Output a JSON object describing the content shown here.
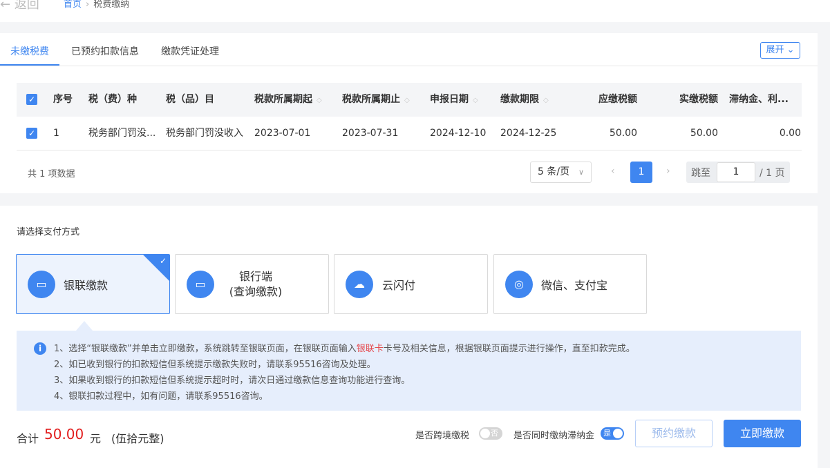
{
  "nav": {
    "back_label": "返回",
    "breadcrumb_home": "首页",
    "breadcrumb_current": "税费缴纳"
  },
  "tabs": {
    "items": [
      {
        "label": "未缴税费",
        "active": true
      },
      {
        "label": "已预约扣款信息",
        "active": false
      },
      {
        "label": "缴款凭证处理",
        "active": false
      }
    ],
    "expand_label": "展开"
  },
  "table": {
    "columns": [
      "序号",
      "税（费）种",
      "税（品）目",
      "税款所属期起",
      "税款所属期止",
      "申报日期",
      "缴款期限",
      "应缴税额",
      "实缴税额",
      "滞纳金、利..."
    ],
    "rows": [
      {
        "index": "1",
        "tax_type": "税务部门罚没...",
        "tax_item": "税务部门罚没收入",
        "period_start": "2023-07-01",
        "period_end": "2023-07-31",
        "declare_date": "2024-12-10",
        "due_date": "2024-12-25",
        "payable": "50.00",
        "paid": "50.00",
        "late_fee": "0.00"
      }
    ],
    "total_text": "共 1 项数据",
    "page_size": "5 条/页",
    "current_page": "1",
    "jump_label": "跳至",
    "jump_value": "1",
    "total_pages": "/ 1 页"
  },
  "payment": {
    "title": "请选择支付方式",
    "methods": [
      {
        "label": "银联缴款",
        "selected": true
      },
      {
        "label_line1": "银行端",
        "label_line2": "(查询缴款)",
        "selected": false
      },
      {
        "label": "云闪付",
        "selected": false
      },
      {
        "label": "微信、支付宝",
        "selected": false
      }
    ],
    "notice": {
      "line1_pre": "1、选择“银联缴款”并单击立即缴款，系统跳转至银联页面，在银联页面输入",
      "line1_red": "银联卡",
      "line1_post": "卡号及相关信息，根据银联页面提示进行操作，直至扣款完成。",
      "line2": "2、如已收到银行的扣款短信但系统提示缴款失败时，请联系95516咨询及处理。",
      "line3": "3、如果收到银行的扣款短信但系统提示超时时，请次日通过缴款信息查询功能进行查询。",
      "line4": "4、银联扣款过程中，如有问题，请联系95516咨询。"
    }
  },
  "summary": {
    "total_label": "合计",
    "total_value": "50.00",
    "unit": "元",
    "amount_words": "(伍拾元整)",
    "cross_border_label": "是否跨境缴税",
    "cross_border_toggle": "否",
    "late_fee_label": "是否同时缴纳滞纳金",
    "late_fee_toggle": "是",
    "schedule_button": "预约缴款",
    "pay_now_button": "立即缴款"
  },
  "colors": {
    "accent": "#3f86f0",
    "total_red": "#e21e1e",
    "notice_bg": "#e6eefc"
  }
}
